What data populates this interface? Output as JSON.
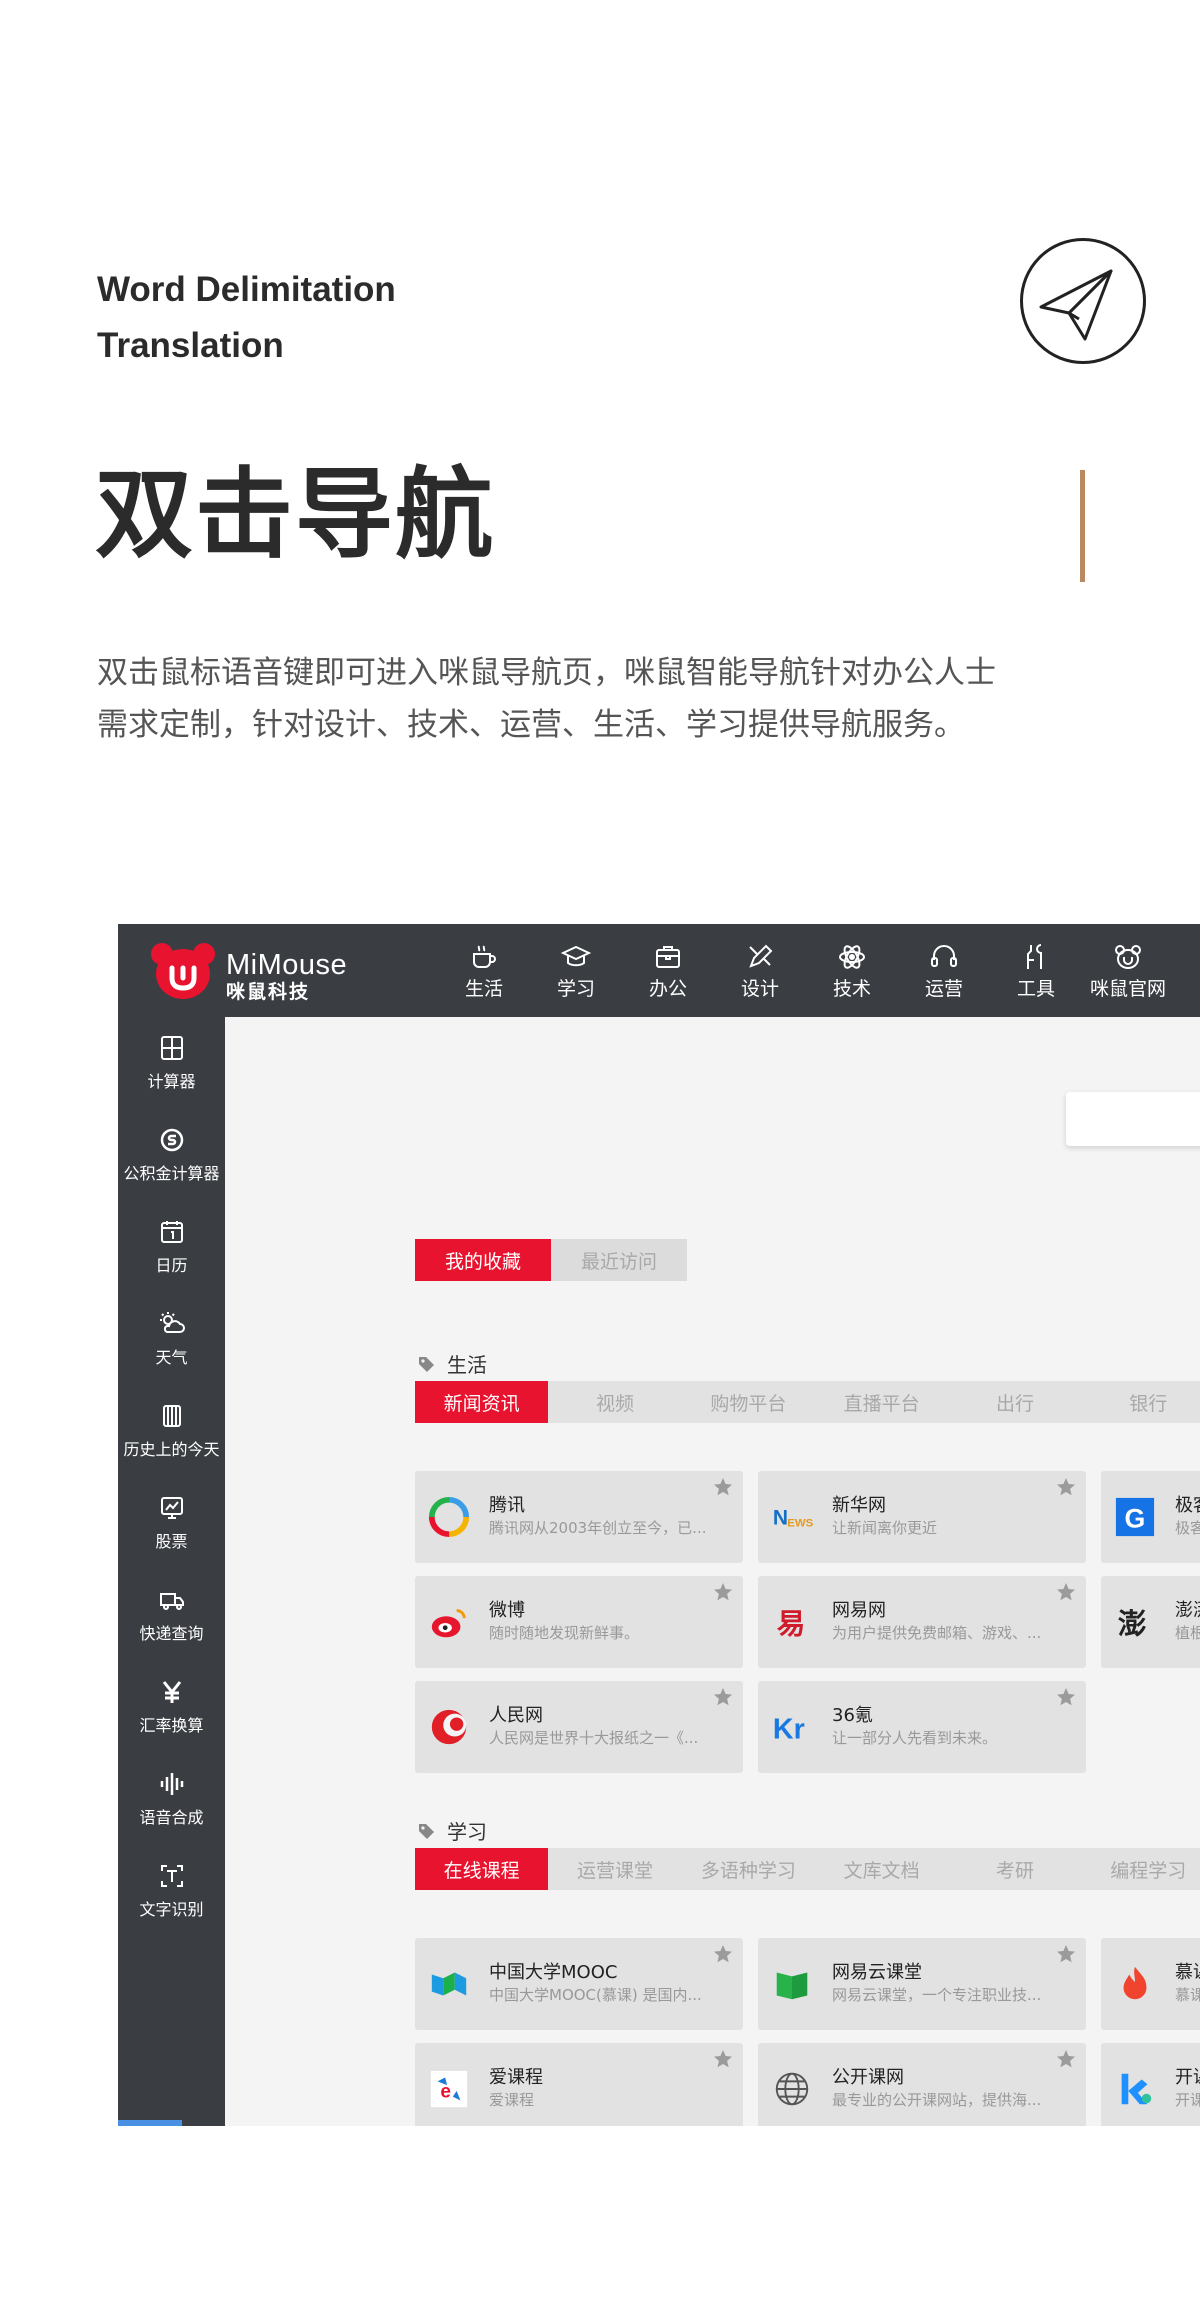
{
  "hero": {
    "subtitle_line1": "Word Delimitation",
    "subtitle_line2": "Translation",
    "title": "双击导航",
    "description_line1": "双击鼠标语音键即可进入咪鼠导航页，咪鼠智能导航针对办公人士",
    "description_line2": "需求定制，针对设计、技术、运营、生活、学习提供导航服务。",
    "icon": "paper-plane-icon",
    "accent_color": "#b98a5f"
  },
  "app": {
    "logo": {
      "en": "MiMouse",
      "cn": "咪鼠科技",
      "color": "#e8132f"
    },
    "nav": [
      {
        "label": "生活",
        "icon": "coffee-icon"
      },
      {
        "label": "学习",
        "icon": "graduation-cap-icon"
      },
      {
        "label": "办公",
        "icon": "briefcase-icon"
      },
      {
        "label": "设计",
        "icon": "design-tools-icon"
      },
      {
        "label": "技术",
        "icon": "atom-icon"
      },
      {
        "label": "运营",
        "icon": "headset-icon"
      },
      {
        "label": "工具",
        "icon": "tools-icon"
      },
      {
        "label": "咪鼠官网",
        "icon": "mouse-logo-icon"
      }
    ],
    "sidebar": [
      {
        "label": "计算器",
        "icon": "calculator-icon"
      },
      {
        "label": "公积金计算器",
        "icon": "fund-icon"
      },
      {
        "label": "日历",
        "icon": "calendar-icon"
      },
      {
        "label": "天气",
        "icon": "weather-icon"
      },
      {
        "label": "历史上的今天",
        "icon": "history-icon"
      },
      {
        "label": "股票",
        "icon": "stock-icon"
      },
      {
        "label": "快递查询",
        "icon": "delivery-icon"
      },
      {
        "label": "汇率换算",
        "icon": "yen-icon"
      },
      {
        "label": "语音合成",
        "icon": "voice-wave-icon"
      },
      {
        "label": "文字识别",
        "icon": "text-recognition-icon"
      }
    ],
    "top_tabs": [
      {
        "label": "我的收藏",
        "active": true
      },
      {
        "label": "最近访问",
        "active": false
      }
    ],
    "sections": [
      {
        "title": "生活",
        "categories": [
          "新闻资讯",
          "视频",
          "购物平台",
          "直播平台",
          "出行",
          "银行"
        ],
        "cards": [
          {
            "title": "腾讯",
            "desc": "腾讯网从2003年创立至今，已...",
            "icon": "tencent-icon"
          },
          {
            "title": "新华网",
            "desc": "让新闻离你更近",
            "icon": "xinhua-icon"
          },
          {
            "title": "极客",
            "desc": "极客",
            "icon": "geek-icon"
          },
          {
            "title": "微博",
            "desc": "随时随地发现新鲜事。",
            "icon": "weibo-icon"
          },
          {
            "title": "网易网",
            "desc": "为用户提供免费邮箱、游戏、...",
            "icon": "netease-icon"
          },
          {
            "title": "澎湃",
            "desc": "植根",
            "icon": "thepaper-icon"
          },
          {
            "title": "人民网",
            "desc": "人民网是世界十大报纸之一《...",
            "icon": "people-icon"
          },
          {
            "title": "36氪",
            "desc": "让一部分人先看到未来。",
            "icon": "36kr-icon"
          }
        ]
      },
      {
        "title": "学习",
        "categories": [
          "在线课程",
          "运营课堂",
          "多语种学习",
          "文库文档",
          "考研",
          "编程学习"
        ],
        "cards": [
          {
            "title": "中国大学MOOC",
            "desc": "中国大学MOOC(慕课) 是国内...",
            "icon": "mooc-icon"
          },
          {
            "title": "网易云课堂",
            "desc": "网易云课堂，一个专注职业技...",
            "icon": "study163-icon"
          },
          {
            "title": "慕课",
            "desc": "慕课",
            "icon": "imooc-icon"
          },
          {
            "title": "爱课程",
            "desc": "爱课程",
            "icon": "icourse-icon"
          },
          {
            "title": "公开课网",
            "desc": "最专业的公开课网站，提供海...",
            "icon": "globe-icon"
          },
          {
            "title": "开课",
            "desc": "开课",
            "icon": "kaike-icon"
          }
        ]
      }
    ]
  }
}
